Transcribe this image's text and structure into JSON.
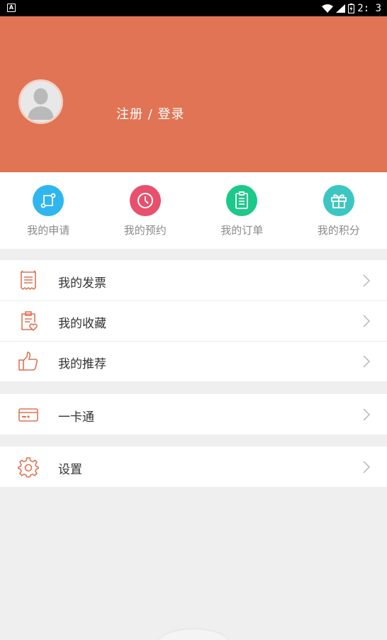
{
  "status_bar": {
    "time": "2: 3"
  },
  "header": {
    "login_text": "注册 / 登录",
    "bg_color": "#e07454"
  },
  "quick_actions": [
    {
      "label": "我的申请",
      "icon": "application-icon",
      "color": "#2fb6ef"
    },
    {
      "label": "我的预约",
      "icon": "clock-icon",
      "color": "#e8506e"
    },
    {
      "label": "我的订单",
      "icon": "order-icon",
      "color": "#1cc88a"
    },
    {
      "label": "我的积分",
      "icon": "gift-icon",
      "color": "#3cc6c1"
    }
  ],
  "menu_groups": [
    [
      {
        "label": "我的发票",
        "icon": "invoice-icon"
      },
      {
        "label": "我的收藏",
        "icon": "favorites-icon"
      },
      {
        "label": "我的推荐",
        "icon": "thumbs-up-icon"
      }
    ],
    [
      {
        "label": "一卡通",
        "icon": "card-icon"
      }
    ],
    [
      {
        "label": "设置",
        "icon": "settings-gear-icon"
      }
    ]
  ],
  "colors": {
    "accent": "#e07454",
    "icon_line": "#e07454"
  }
}
